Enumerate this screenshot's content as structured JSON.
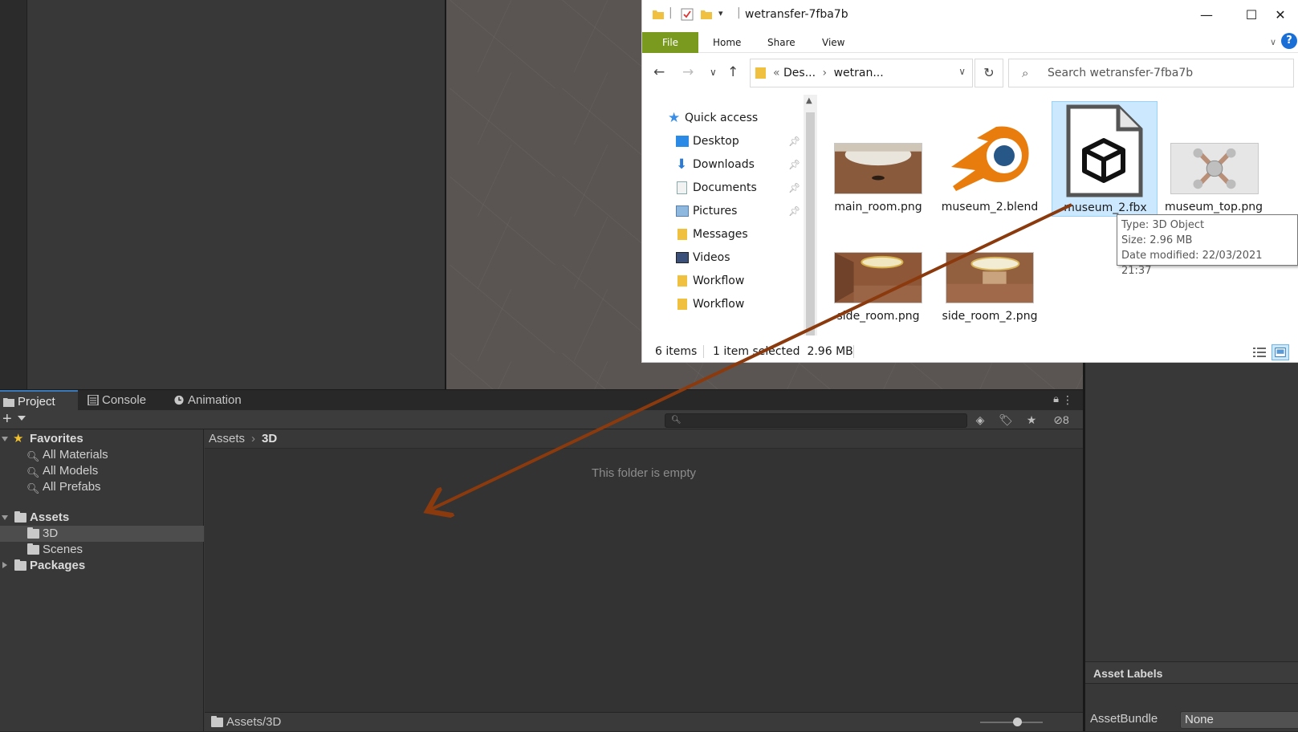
{
  "explorer": {
    "title": "wetransfer-7fba7b",
    "ribbon_tabs": [
      "File",
      "Home",
      "Share",
      "View"
    ],
    "address": {
      "part1": "Des...",
      "part2": "wetran..."
    },
    "search_placeholder": "Search wetransfer-7fba7b",
    "nav_items": [
      {
        "label": "Quick access",
        "icon": "star-icon",
        "pinned": false
      },
      {
        "label": "Desktop",
        "icon": "desktop-icon",
        "pinned": true
      },
      {
        "label": "Downloads",
        "icon": "download-icon",
        "pinned": true
      },
      {
        "label": "Documents",
        "icon": "document-icon",
        "pinned": true
      },
      {
        "label": "Pictures",
        "icon": "pictures-icon",
        "pinned": true
      },
      {
        "label": "Messages",
        "icon": "folder-icon",
        "pinned": false
      },
      {
        "label": "Videos",
        "icon": "video-icon",
        "pinned": false
      },
      {
        "label": "Workflow",
        "icon": "folder-icon",
        "pinned": false
      },
      {
        "label": "Workflow",
        "icon": "folder-icon",
        "pinned": false
      }
    ],
    "files": [
      {
        "name": "main_room.png",
        "kind": "image"
      },
      {
        "name": "museum_2.blend",
        "kind": "blender"
      },
      {
        "name": "museum_2.fbx",
        "kind": "fbx",
        "selected": true
      },
      {
        "name": "museum_top.png",
        "kind": "image"
      },
      {
        "name": "side_room.png",
        "kind": "image"
      },
      {
        "name": "side_room_2.png",
        "kind": "image"
      }
    ],
    "tooltip": {
      "type": "Type: 3D Object",
      "size": "Size: 2.96 MB",
      "modified": "Date modified: 22/03/2021 21:37"
    },
    "status": {
      "items": "6 items",
      "selected": "1 item selected",
      "size": "2.96 MB"
    }
  },
  "project": {
    "tabs": [
      "Project",
      "Console",
      "Animation"
    ],
    "hidden_count": "8",
    "tree": {
      "favorites": "Favorites",
      "fav_items": [
        "All Materials",
        "All Models",
        "All Prefabs"
      ],
      "assets": "Assets",
      "asset_children": [
        "3D",
        "Scenes"
      ],
      "packages": "Packages"
    },
    "breadcrumb": {
      "root": "Assets",
      "current": "3D"
    },
    "empty_message": "This folder is empty",
    "footer_path": "Assets/3D"
  },
  "inspector": {
    "asset_labels": "Asset Labels",
    "assetbundle_label": "AssetBundle",
    "assetbundle_value": "None"
  },
  "colors": {
    "unity_selection": "#4d4d4d",
    "explorer_selection": "#cce8ff",
    "drag_arrow": "#8b3a0e",
    "file_tab": "#7a9a1f"
  }
}
